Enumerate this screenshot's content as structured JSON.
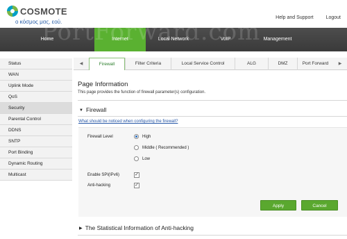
{
  "brand": {
    "name": "COSMOTE",
    "tagline": "ο κόσμος μας, εού."
  },
  "top_links": {
    "help": "Help and Support",
    "logout": "Logout"
  },
  "nav": {
    "items": [
      "Home",
      "Internet",
      "Local Network",
      "VoIP",
      "Management"
    ],
    "active": "Internet"
  },
  "watermark": "PortForward.com",
  "sidebar": {
    "items": [
      "Status",
      "WAN",
      "Uplink Mode",
      "QoS",
      "Security",
      "Parental Control",
      "DDNS",
      "SNTP",
      "Port Binding",
      "Dynamic Routing",
      "Multicast"
    ],
    "active": "Security"
  },
  "tabs": {
    "prev_arrow": "◀",
    "items": [
      "Firewall",
      "Filter Criteria",
      "Local Service Control",
      "ALG",
      "DMZ",
      "Port Forward"
    ],
    "next_arrow": "▶",
    "active": "Firewall"
  },
  "page": {
    "title": "Page Information",
    "description": "This page provides the function of firewall parameter(s) configuration."
  },
  "firewall": {
    "section_title": "Firewall",
    "help_link": "What should be noticed when configuring the firewall?",
    "level_label": "Firewall Level",
    "level_options": [
      "High",
      "Middle ( Recommended )",
      "Low"
    ],
    "level_selected": "High",
    "spi_label": "Enable SPI(IPv6)",
    "spi_checked": true,
    "anti_hacking_label": "Anti-hacking",
    "anti_hacking_checked": true,
    "apply_label": "Apply",
    "cancel_label": "Cancel"
  },
  "stats_section_title": "The Statistical Information of Anti-hacking",
  "icons": {
    "section_expanded": "triangle-down-icon",
    "section_collapsed": "triangle-right-icon",
    "checkmark": "✓"
  },
  "colors": {
    "accent_green": "#5ab131",
    "nav_bg": "#434343",
    "link_blue": "#2556a6"
  }
}
